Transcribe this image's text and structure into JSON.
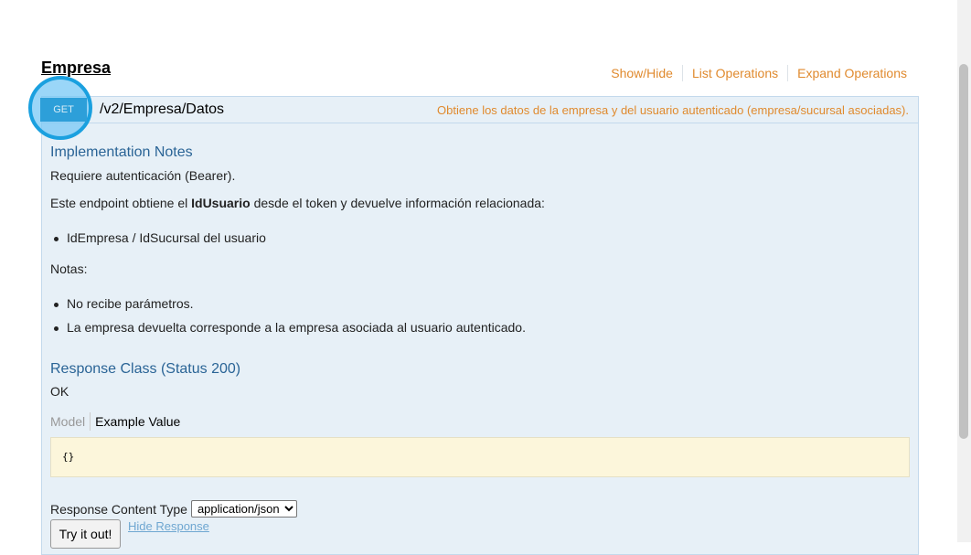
{
  "resource": {
    "title": "Empresa",
    "actions": [
      "Show/Hide",
      "List Operations",
      "Expand Operations"
    ]
  },
  "operation": {
    "method": "GET",
    "path": "/v2/Empresa/Datos",
    "summary": "Obtiene los datos de la empresa y del usuario autenticado (empresa/sucursal asociadas)."
  },
  "implementation_notes": {
    "title": "Implementation Notes",
    "p1": "Requiere autenticación (Bearer).",
    "p2_before": "Este endpoint obtiene el ",
    "p2_bold": "IdUsuario",
    "p2_after": " desde el token y devuelve información relacionada:",
    "list1": [
      "IdEmpresa / IdSucursal del usuario"
    ],
    "notes_label": "Notas:",
    "list2": [
      "No recibe parámetros.",
      "La empresa devuelta corresponde a la empresa asociada al usuario autenticado."
    ]
  },
  "response_class": {
    "title": "Response Class (Status 200)",
    "status_text": "OK",
    "tab_model": "Model",
    "tab_example": "Example Value",
    "example_value": "{}"
  },
  "request": {
    "content_type_label": "Response Content Type",
    "content_type_value": "application/json",
    "try_button": "Try it out!",
    "hide_response": "Hide Response"
  },
  "colors": {
    "accent_orange": "#e08a2e",
    "get_blue": "#2d9fd9",
    "heading_blue": "#2a6496",
    "op_background": "#e7f0f7"
  }
}
